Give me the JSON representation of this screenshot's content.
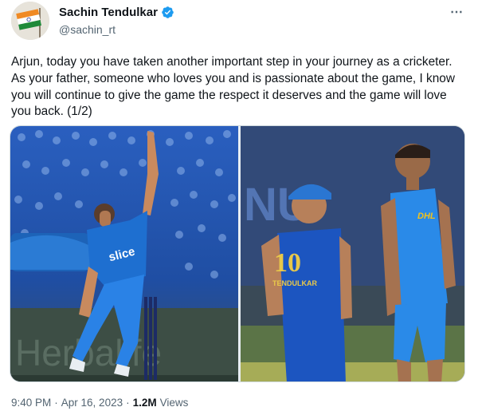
{
  "author": {
    "name": "Sachin Tendulkar",
    "handle": "@sachin_rt",
    "verified": true
  },
  "more_icon": "⋯",
  "tweet_text": "Arjun, today you have taken another important step in your journey as a cricketer. As your father, someone who loves you and is passionate about the game, I know you will continue to give the game the respect it deserves and the game will love you back. (1/2)",
  "media": {
    "left_photo": {
      "sponsor_text": "slice",
      "board_text": "Herbalife"
    },
    "right_photo": {
      "jersey_number": "10",
      "jersey_name": "TENDULKAR",
      "sponsor_text": "DHL",
      "bg_text": "NU"
    }
  },
  "meta": {
    "time": "9:40 PM",
    "separator": "·",
    "date": "Apr 16, 2023",
    "views_count": "1.2M",
    "views_label": "Views"
  },
  "colors": {
    "verified_blue": "#1d9bf0",
    "mi_blue": "#1e5fc7",
    "secondary_text": "#536471"
  }
}
